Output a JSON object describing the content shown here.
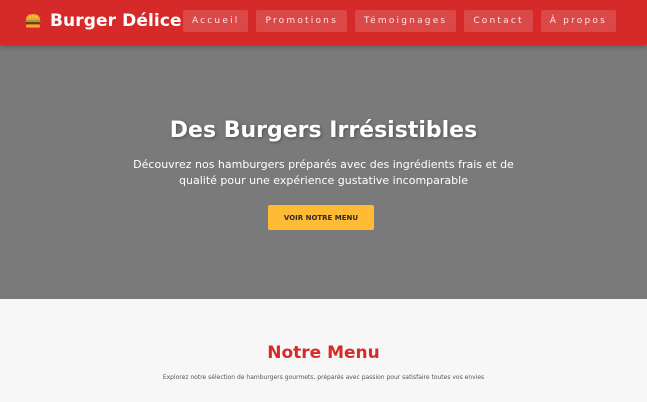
{
  "brand": {
    "name": "Burger Délice",
    "icon": "burger-icon"
  },
  "nav": {
    "items": [
      {
        "label": "Accueil"
      },
      {
        "label": "Promotions"
      },
      {
        "label": "Témoignages"
      },
      {
        "label": "Contact"
      },
      {
        "label": "À propos"
      }
    ]
  },
  "hero": {
    "title": "Des Burgers Irrésistibles",
    "subtitle": "Découvrez nos hamburgers préparés avec des ingrédients frais et de qualité pour une expérience gustative incomparable",
    "cta_label": "VOIR NOTRE MENU"
  },
  "menu_section": {
    "title": "Notre Menu",
    "subtitle": "Explorez notre sélection de hamburgers gourmets, préparés avec passion pour satisfaire toutes vos envies"
  },
  "colors": {
    "primary": "#d62a2a",
    "accent": "#ffbb33",
    "hero_bg": "#7a7a7a",
    "section_bg": "#f7f7f7"
  }
}
